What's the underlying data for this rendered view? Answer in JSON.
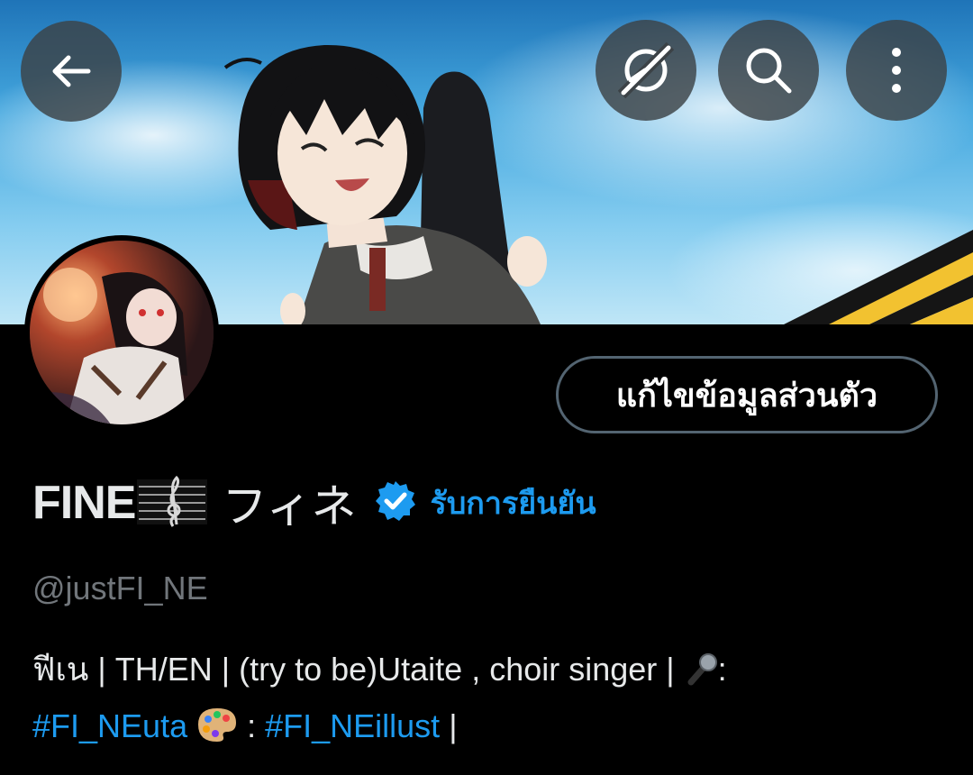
{
  "header": {
    "back_icon": "arrow-left-icon",
    "grok_icon": "grok-icon",
    "search_icon": "search-icon",
    "more_icon": "more-vertical-icon"
  },
  "profile": {
    "edit_button_label": "แก้ไขข้อมูลส่วนตัว",
    "name_main": "FINE",
    "name_icon": "musical-score-icon",
    "name_kana": "フィネ",
    "verify_label": "รับการยืนยัน",
    "handle": "@justFI_NE",
    "bio": {
      "line1": "ฟีเน | TH/EN | (try to be)Utaite , choir singer | ",
      "mic_icon": "microphone-icon",
      "after_mic": ":",
      "hashtag1": "#FI_NEuta",
      "palette_icon": "artist-palette-icon",
      "separator": " : ",
      "hashtag2": "#FI_NEillust",
      "tail": " |"
    }
  },
  "colors": {
    "background": "#000000",
    "accent": "#1d9bf0",
    "secondary_text": "#71767b",
    "border": "#536471"
  }
}
